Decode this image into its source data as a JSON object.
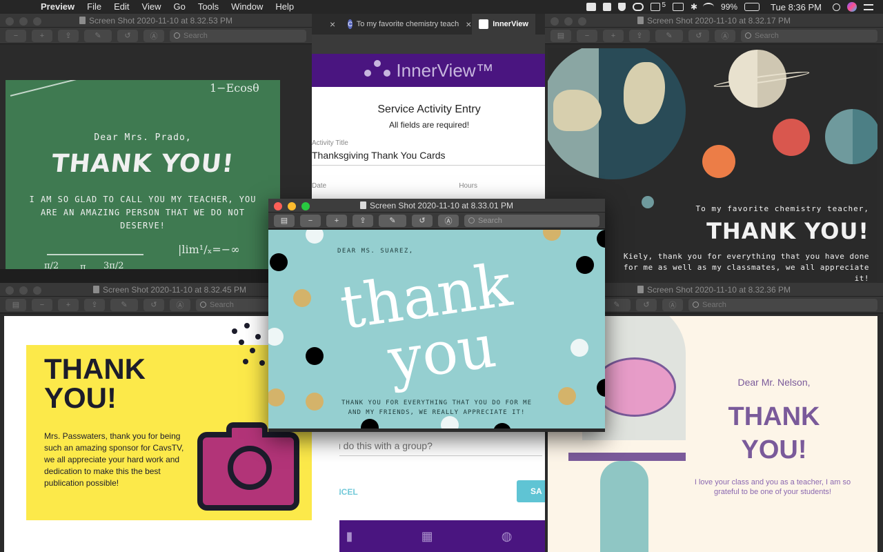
{
  "menubar": {
    "app": "Preview",
    "menus": [
      "File",
      "Edit",
      "View",
      "Go",
      "Tools",
      "Window",
      "Help"
    ],
    "notification_count": "5",
    "battery": "99%",
    "clock": "Tue 8:36 PM"
  },
  "win_chalk": {
    "title": "Screen Shot 2020-11-10 at 8.32.53 PM",
    "search_placeholder": "Search",
    "card": {
      "greeting": "Dear Mrs. Prado,",
      "headline": "THANK YOU!",
      "message": "I am so glad to call you my teacher, you are an amazing person that we do not deserve!",
      "scribbles": [
        "1−Ecosθ",
        "|lim¹/ₓ=−∞",
        "π/2",
        "3π/2",
        "π"
      ]
    }
  },
  "browser": {
    "tab1": "To my favorite chemistry teach",
    "tab2": "InnerView",
    "brand": "InnerView™",
    "form": {
      "title": "Service Activity Entry",
      "subtitle": "All fields are required!",
      "field_label": "Activity Title",
      "field_value": "Thanksgiving Thank You Cards",
      "date_label": "Date",
      "hours_label": "Hours",
      "group_question": "u do this with a group?",
      "cancel": "NCEL",
      "save": "SA"
    }
  },
  "win_space": {
    "title": "Screen Shot 2020-11-10 at 8.32.17 PM",
    "search_placeholder": "Search",
    "card": {
      "to": "To my favorite chemistry teacher,",
      "headline": "THANK YOU!",
      "message": "Kiely, thank you for everything that you have done for me as well as my classmates, we all appreciate it!"
    }
  },
  "win_yellow": {
    "title": "Screen Shot 2020-11-10 at 8.32.45 PM",
    "search_placeholder": "Search",
    "card": {
      "headline_1": "THANK",
      "headline_2": "YOU!",
      "message": "Mrs. Passwaters, thank you for being such an amazing sponsor for CavsTV, we all appreciate your hard work and dedication to make this the best publication possible!"
    }
  },
  "win_teal": {
    "title": "Screen Shot 2020-11-10 at 8.33.01 PM",
    "search_placeholder": "Search",
    "card": {
      "greeting": "DEAR MS. SUAREZ,",
      "word1": "thank",
      "word2": "you",
      "message_1": "THANK YOU FOR EVERYTHING THAT YOU DO FOR ME",
      "message_2": "AND MY FRIENDS, WE REALLY APPRECIATE IT!"
    }
  },
  "win_cream": {
    "title": "Screen Shot 2020-11-10 at 8.32.36 PM",
    "search_placeholder": "Search",
    "card": {
      "greeting": "Dear Mr. Nelson,",
      "headline_1": "THANK",
      "headline_2": "YOU!",
      "message": "I love your class and you as a teacher, I am so grateful to be one of your students!"
    }
  },
  "colors": {
    "chalkboard": "#3f7a51",
    "innerview_purple": "#4a1580",
    "teal_card": "#95cfd0",
    "yellow_box": "#fce94a",
    "cream_card": "#fdf5e8",
    "cream_text": "#7a5a9a"
  }
}
